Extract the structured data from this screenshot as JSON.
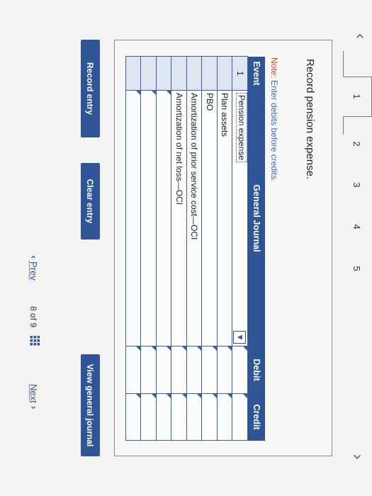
{
  "tabs": [
    "1",
    "2",
    "3",
    "4",
    "5"
  ],
  "instruction": "Record pension expense.",
  "note": {
    "label": "Note:",
    "text": "Enter debits before credits."
  },
  "table": {
    "headers": {
      "event": "Event",
      "journal": "General Journal",
      "debit": "Debit",
      "credit": "Credit"
    },
    "rows": [
      {
        "event": "1",
        "account": "Pension expense",
        "debit": "",
        "credit": ""
      },
      {
        "event": "",
        "account": "Plan assets",
        "debit": "",
        "credit": ""
      },
      {
        "event": "",
        "account": "PBO",
        "debit": "",
        "credit": ""
      },
      {
        "event": "",
        "account": "Amortization of prior service cost—OCI",
        "debit": "",
        "credit": ""
      },
      {
        "event": "",
        "account": "Amortization of net loss—OCI",
        "debit": "",
        "credit": ""
      },
      {
        "event": "",
        "account": "",
        "debit": "",
        "credit": ""
      },
      {
        "event": "",
        "account": "",
        "debit": "",
        "credit": ""
      },
      {
        "event": "",
        "account": "",
        "debit": "",
        "credit": ""
      }
    ]
  },
  "buttons": {
    "record": "Record entry",
    "clear": "Clear entry",
    "view": "View general journal"
  },
  "pagination": {
    "prev": "Prev",
    "current": "8",
    "of_label": "of",
    "total": "9",
    "next": "Next"
  },
  "colors": {
    "accent": "#2f5597",
    "note_label": "#c0503f"
  },
  "icons": {
    "prev_arrow": "chevron-left-icon",
    "next_arrow": "chevron-right-icon",
    "dropdown": "caret-down-icon",
    "grid": "grid-icon"
  }
}
